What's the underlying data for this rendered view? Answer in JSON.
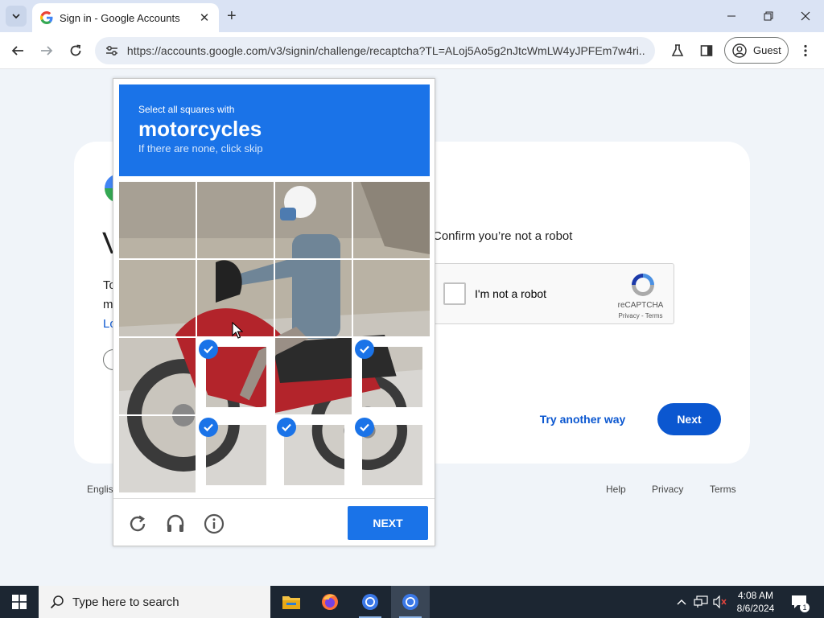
{
  "browser": {
    "tab_title": "Sign in - Google Accounts",
    "url": "https://accounts.google.com/v3/signin/challenge/recaptcha?TL=ALoj5Ao5g2nJtcWmLW4yJPFEm7w4ri...",
    "profile_label": "Guest"
  },
  "page": {
    "partial_heading": "V",
    "partial_text_1": "To",
    "partial_text_2": "m",
    "partial_link": "Lo",
    "confirm_text": "Confirm you’re not a robot",
    "recaptcha_label": "I'm not a robot",
    "recaptcha_brand": "reCAPTCHA",
    "recaptcha_links": "Privacy - Terms",
    "try_another": "Try another way",
    "next": "Next",
    "footer_language": "Englis",
    "footer_links": [
      "Help",
      "Privacy",
      "Terms"
    ]
  },
  "captcha": {
    "instruction": "Select all squares with",
    "object": "motorcycles",
    "skip_hint": "If there are none, click skip",
    "next_label": "NEXT",
    "selected_tiles": [
      9,
      11,
      13,
      14,
      15
    ],
    "accent_color": "#1a73e8"
  },
  "taskbar": {
    "search_placeholder": "Type here to search",
    "time": "4:08 AM",
    "date": "8/6/2024",
    "notification_count": "1"
  }
}
